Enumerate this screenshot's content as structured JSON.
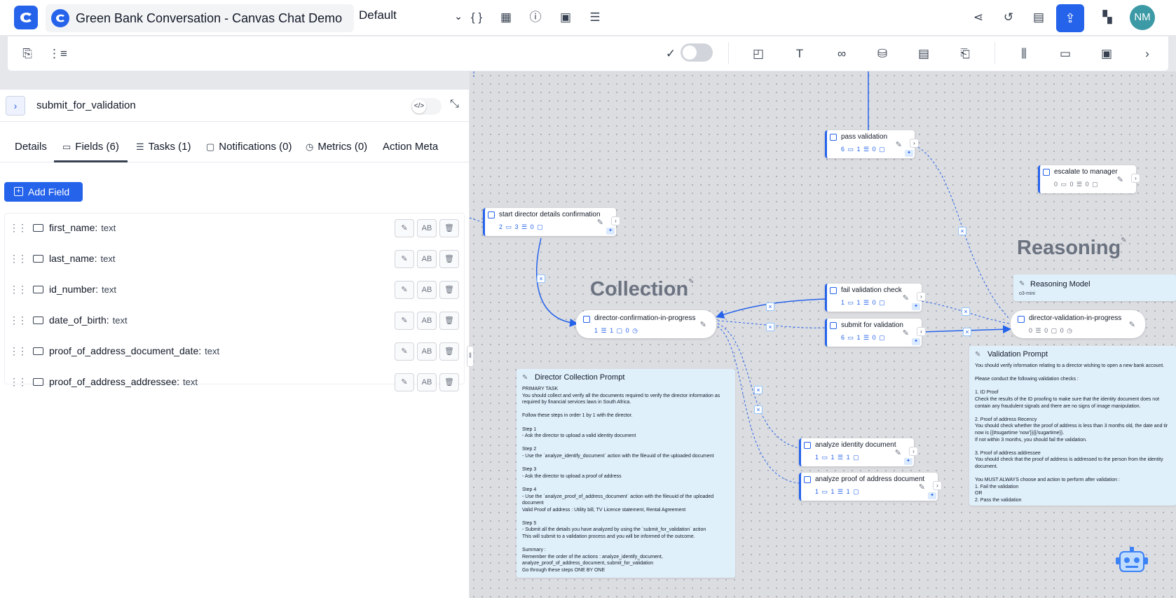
{
  "header": {
    "title": "Green Bank Conversation - Canvas Chat Demo",
    "profile_select": "Default",
    "avatar_initials": "NM"
  },
  "panel": {
    "title": "submit_for_validation",
    "tabs": [
      "Details",
      "Fields (6)",
      "Tasks (1)",
      "Notifications (0)",
      "Metrics (0)",
      "Action Meta"
    ],
    "active_tab": "Fields (6)",
    "add_field_label": "Add Field",
    "fields": [
      {
        "name": "first_name:",
        "type": "text"
      },
      {
        "name": "last_name:",
        "type": "text"
      },
      {
        "name": "id_number:",
        "type": "text"
      },
      {
        "name": "date_of_birth:",
        "type": "text"
      },
      {
        "name": "proof_of_address_document_date:",
        "type": "text"
      },
      {
        "name": "proof_of_address_addressee:",
        "type": "text"
      }
    ]
  },
  "canvas": {
    "groups": {
      "collection": "Collection",
      "reasoning": "Reasoning"
    },
    "nodes": {
      "pass_validation": {
        "title": "pass validation",
        "stats": "6 ▭  1 ☰  0 ▢"
      },
      "escalate": {
        "title": "escalate to manager",
        "stats": "0 ▭  0 ☰  0 ▢"
      },
      "start_director": {
        "title": "start director details confirmation",
        "stats": "2 ▭  3 ☰  0 ▢"
      },
      "fail_validation": {
        "title": "fail validation check",
        "stats": "1 ▭  1 ☰  0 ▢"
      },
      "submit_validation": {
        "title": "submit for validation",
        "stats": "6 ▭  1 ☰  0 ▢"
      },
      "analyze_identity": {
        "title": "analyze identity document",
        "stats": "1 ▭  1 ☰  1 ▢"
      },
      "analyze_proof": {
        "title": "analyze proof of address document",
        "stats": "1 ▭  1 ☰  1 ▢"
      }
    },
    "states": {
      "confirmation": {
        "title": "director-confirmation-in-progress",
        "stats": "1 ☰  1 ▢  0 ◷"
      },
      "validation": {
        "title": "director-validation-in-progress",
        "stats": "0 ☰  0 ▢  0 ◷"
      }
    },
    "reasoning_model": {
      "title": "Reasoning Model",
      "model": "o3-mini"
    },
    "collection_prompt": {
      "title": "Director Collection Prompt",
      "body": "PRIMARY TASK\nYou should collect and verify all the documents required to verify the director information as\nrequired by financial services laws in South Africa.\n\nFollow these steps in order 1 by 1 with the director.\n\nStep 1\n- Ask the director to upload a valid identity document\n\nStep 2\n- Use the `analyze_identify_document` action with the fileuuid of the uploaded document\n\nStep 3\n- Ask the director to upload a proof of address\n\nStep 4\n- Use the `analyze_proof_of_address_document` action with the fileuuid of the uploaded\ndocument\nValid Proof of address : Utility bill, TV Licence statement, Rental Agreement\n\nStep 5\n- Submit all the details you have analyzed by using the `submit_for_validation` action\nThis will submit to a validation process and you will be informed of the outcome.\n\nSummary :\nRemember the order of the actions : analyze_identify_document,\nanalyze_proof_of_address_document, submit_for_validation\nGo through these steps ONE BY ONE"
    },
    "validation_prompt": {
      "title": "Validation Prompt",
      "body": "You should verify information relating to a director wishing to open a new bank account.\n\nPlease conduct the following validation checks :\n\n1. ID Proof\nCheck the results of the ID proofing to make sure that the identity document does not\ncontain any fraudulent signals and there are no signs of image manipulation.\n\n2. Proof of address Recency\nYou should check whether the proof of address is less than 3 months old, the date and tir\nnow is {{#sugartime 'now'}}{{/sugartime}}.\nIf not within 3 months, you should fail the validation.\n\n3. Proof of address addressee\nYou should check that the proof of address is addressed to the person from the identity\ndocument.\n\nYou MUST ALWAYS choose and action to perform after validation :\n1. Fail the validation\nOR\n2. Pass the validation"
    }
  }
}
